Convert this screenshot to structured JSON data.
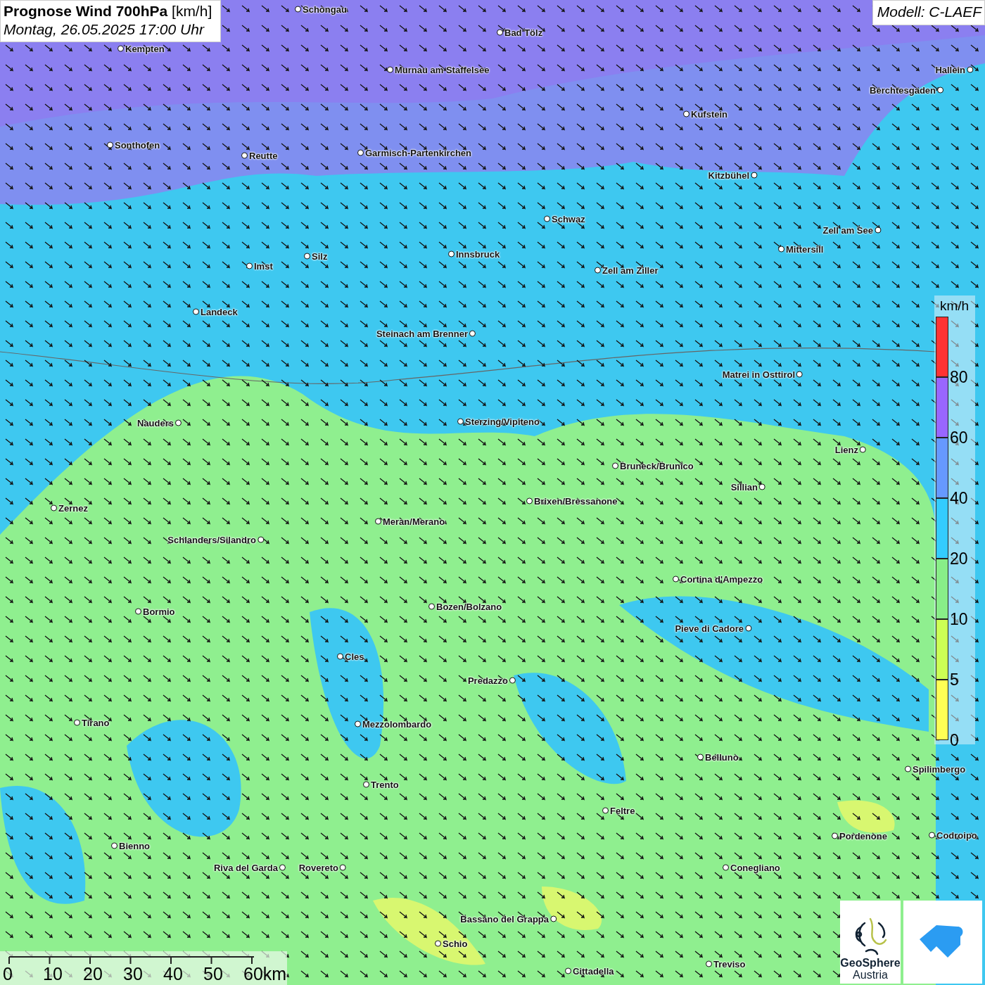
{
  "title": {
    "main": "Prognose Wind 700hPa",
    "unit": "[km/h]",
    "date": "Montag, 26.05.2025 17:00 Uhr"
  },
  "model": "Modell: C-LAEF",
  "cities": [
    "Schongau",
    "Bad Tölz",
    "Kempten",
    "Murnau am Staffelsee",
    "Hallein",
    "Berchtesgaden",
    "Kufstein",
    "Sonthofen",
    "Reutte",
    "Garmisch-Partenkirchen",
    "Kitzbühel",
    "Schwaz",
    "Zell am See",
    "Mittersill",
    "Innsbruck",
    "Silz",
    "Imst",
    "Zell am Ziller",
    "Landeck",
    "Steinach am Brenner",
    "Matrei in Osttirol",
    "Nauders",
    "Sterzing/Vipiteno",
    "Lienz",
    "Bruneck/Brunico",
    "Sillian",
    "Brixen/Bressanone",
    "Zernez",
    "Meran/Merano",
    "Schlanders/Silandro",
    "Cortina d'Ampezzo",
    "Bozen/Bolzano",
    "Bormio",
    "Pieve di Cadore",
    "Cles",
    "Predazzo",
    "Tirano",
    "Mezzolombardo",
    "Belluno",
    "Spilimbergo",
    "Trento",
    "Feltre",
    "Pordenone",
    "Codroipo",
    "Bienno",
    "Riva del Garda",
    "Rovereto",
    "Conegliano",
    "Bassano del Grappa",
    "Schio",
    "Treviso",
    "Cittadella"
  ],
  "legend": {
    "unit": "km/h",
    "steps": [
      {
        "label": "80",
        "color": "#ff3333"
      },
      {
        "label": "60",
        "color": "#9966ff"
      },
      {
        "label": "40",
        "color": "#6699ff"
      },
      {
        "label": "20",
        "color": "#33ccff"
      },
      {
        "label": "10",
        "color": "#88ee88"
      },
      {
        "label": "5",
        "color": "#ccff55"
      },
      {
        "label": "0",
        "color": "#ffff55"
      }
    ]
  },
  "scale": [
    "0",
    "10",
    "20",
    "30",
    "40",
    "50",
    "60km"
  ],
  "logos": {
    "geosphere": [
      "GeoSphere",
      "Austria"
    ]
  }
}
